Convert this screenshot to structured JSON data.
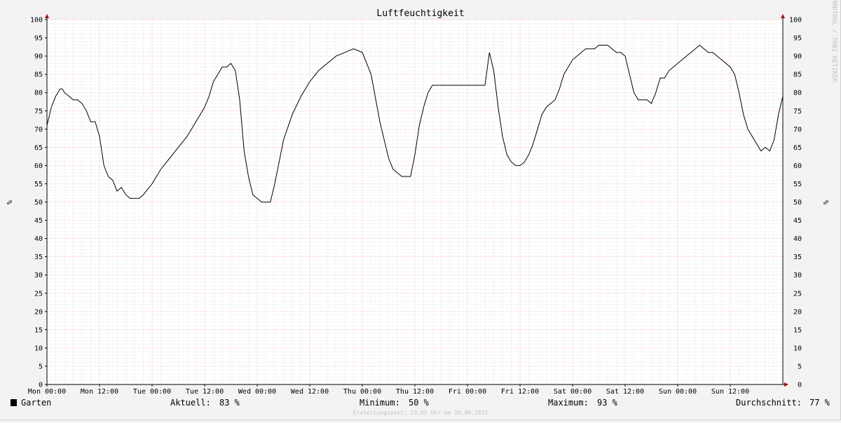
{
  "chart_data": {
    "type": "line",
    "title": "Luftfeuchtigkeit",
    "ylabel": "%",
    "ylim": [
      0,
      100
    ],
    "yticks": [
      0,
      5,
      10,
      15,
      20,
      25,
      30,
      35,
      40,
      45,
      50,
      55,
      60,
      65,
      70,
      75,
      80,
      85,
      90,
      95,
      100
    ],
    "xlim_hours": [
      0,
      168
    ],
    "xticks": [
      "Mon 00:00",
      "Mon 12:00",
      "Tue 00:00",
      "Tue 12:00",
      "Wed 00:00",
      "Wed 12:00",
      "Thu 00:00",
      "Thu 12:00",
      "Fri 00:00",
      "Fri 12:00",
      "Sat 00:00",
      "Sat 12:00",
      "Sun 00:00",
      "Sun 12:00"
    ],
    "grid": true,
    "series": [
      {
        "name": "Garten",
        "color": "#000000",
        "x_hours": [
          0,
          1,
          2,
          3,
          3.5,
          4,
          5,
          6,
          7,
          8,
          9,
          10,
          11,
          12,
          13,
          14,
          15,
          16,
          17,
          18,
          19,
          20,
          21,
          22,
          24,
          26,
          28,
          30,
          32,
          33,
          34,
          35,
          36,
          37,
          38,
          39,
          40,
          41,
          42,
          43,
          44,
          45,
          46,
          47,
          48,
          49,
          50,
          51,
          52,
          53,
          54,
          56,
          58,
          60,
          62,
          64,
          66,
          68,
          70,
          72,
          74,
          76,
          78,
          79,
          80,
          81,
          82,
          83,
          84,
          85,
          86,
          87,
          88,
          89,
          90,
          91,
          92,
          93,
          94,
          95,
          96,
          97,
          98,
          99,
          100,
          101,
          102,
          103,
          104,
          105,
          106,
          107,
          108,
          109,
          110,
          111,
          112,
          113,
          114,
          115,
          116,
          117,
          118,
          119,
          120,
          121,
          122,
          123,
          124,
          125,
          126,
          127,
          128,
          129,
          130,
          131,
          132,
          133,
          134,
          135,
          136,
          137,
          138,
          139,
          140,
          141,
          142,
          143,
          144,
          145,
          146,
          147,
          148,
          149,
          150,
          151,
          152,
          153,
          154,
          155,
          156,
          157,
          158,
          159,
          160,
          161,
          162,
          163,
          164,
          165,
          166,
          167,
          168
        ],
        "values": [
          71,
          76,
          79,
          81,
          81,
          80,
          79,
          78,
          78,
          77,
          75,
          72,
          72,
          68,
          60,
          57,
          56,
          53,
          54,
          52,
          51,
          51,
          51,
          52,
          55,
          59,
          62,
          65,
          68,
          70,
          72,
          74,
          76,
          79,
          83,
          85,
          87,
          87,
          88,
          86,
          78,
          64,
          57,
          52,
          51,
          50,
          50,
          50,
          55,
          61,
          67,
          74,
          79,
          83,
          86,
          88,
          90,
          91,
          92,
          91,
          85,
          72,
          62,
          59,
          58,
          57,
          57,
          57,
          63,
          71,
          76,
          80,
          82,
          82,
          82,
          82,
          82,
          82,
          82,
          82,
          82,
          82,
          82,
          82,
          82,
          91,
          86,
          76,
          68,
          63,
          61,
          60,
          60,
          61,
          63,
          66,
          70,
          74,
          76,
          77,
          78,
          81,
          85,
          87,
          89,
          90,
          91,
          92,
          92,
          92,
          93,
          93,
          93,
          92,
          91,
          91,
          90,
          85,
          80,
          78,
          78,
          78,
          77,
          80,
          84,
          84,
          86,
          87,
          88,
          89,
          90,
          91,
          92,
          93,
          92,
          91,
          91,
          90,
          89,
          88,
          87,
          85,
          80,
          74,
          70,
          68,
          66,
          64,
          65,
          64,
          67,
          74,
          79,
          83,
          86,
          89,
          90,
          91,
          92,
          92,
          92,
          93,
          92,
          92,
          93,
          93,
          93,
          91,
          86,
          80,
          73,
          67,
          65,
          63,
          66,
          69,
          72,
          75,
          77,
          78,
          79,
          81,
          83
        ]
      }
    ]
  },
  "side_text": "RRDTOOL / TOBI OETIKER",
  "legend": {
    "series_name": "Garten",
    "swatch_color": "#000000",
    "current_label": "Aktuell:",
    "current_value": "83 %",
    "min_label": "Minimum:",
    "min_value": "50 %",
    "max_label": "Maximum:",
    "max_value": "93 %",
    "avg_label": "Durchschnitt:",
    "avg_value": "77 %"
  },
  "footer": "Erstellungszeit: 23:55 Uhr am 26.09.2021",
  "colors": {
    "background": "#f3f3f3",
    "plot_background": "#ffffff",
    "minor_grid": "#c8c8c8",
    "major_grid": "#e0a0a0",
    "axis_arrow": "#a01010"
  }
}
